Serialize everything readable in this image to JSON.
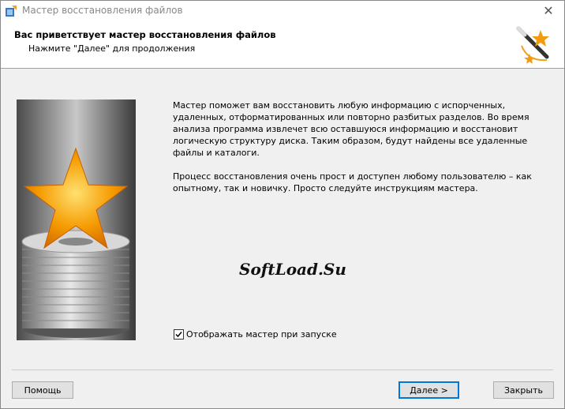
{
  "window": {
    "title": "Мастер восстановления файлов",
    "close_glyph": "✕"
  },
  "header": {
    "title": "Вас приветствует мастер восстановления файлов",
    "subtitle": "Нажмите \"Далее\" для продолжения",
    "icon": "magic-wand-icon"
  },
  "banner": {
    "icon": "star-on-disks-image"
  },
  "description": {
    "paragraph1": "Мастер поможет вам восстановить любую информацию с испорченных, удаленных, отформатированных или повторно разбитых разделов. Во время анализа программа извлечет всю оставшуюся информацию и восстановит логическую структуру диска. Таким образом, будут найдены все удаленные файлы и каталоги.",
    "paragraph2": "Процесс восстановления очень прост и доступен любому пользователю – как опытному, так и новичку. Просто следуйте инструкциям мастера."
  },
  "watermark": "SoftLoad.Su",
  "show_on_start": {
    "label": "Отображать мастер при запуске",
    "checked": true
  },
  "buttons": {
    "help": "Помощь",
    "next": "Далее >",
    "close": "Закрыть"
  },
  "colors": {
    "accent": "#0078d7",
    "star": "#f59a00"
  }
}
